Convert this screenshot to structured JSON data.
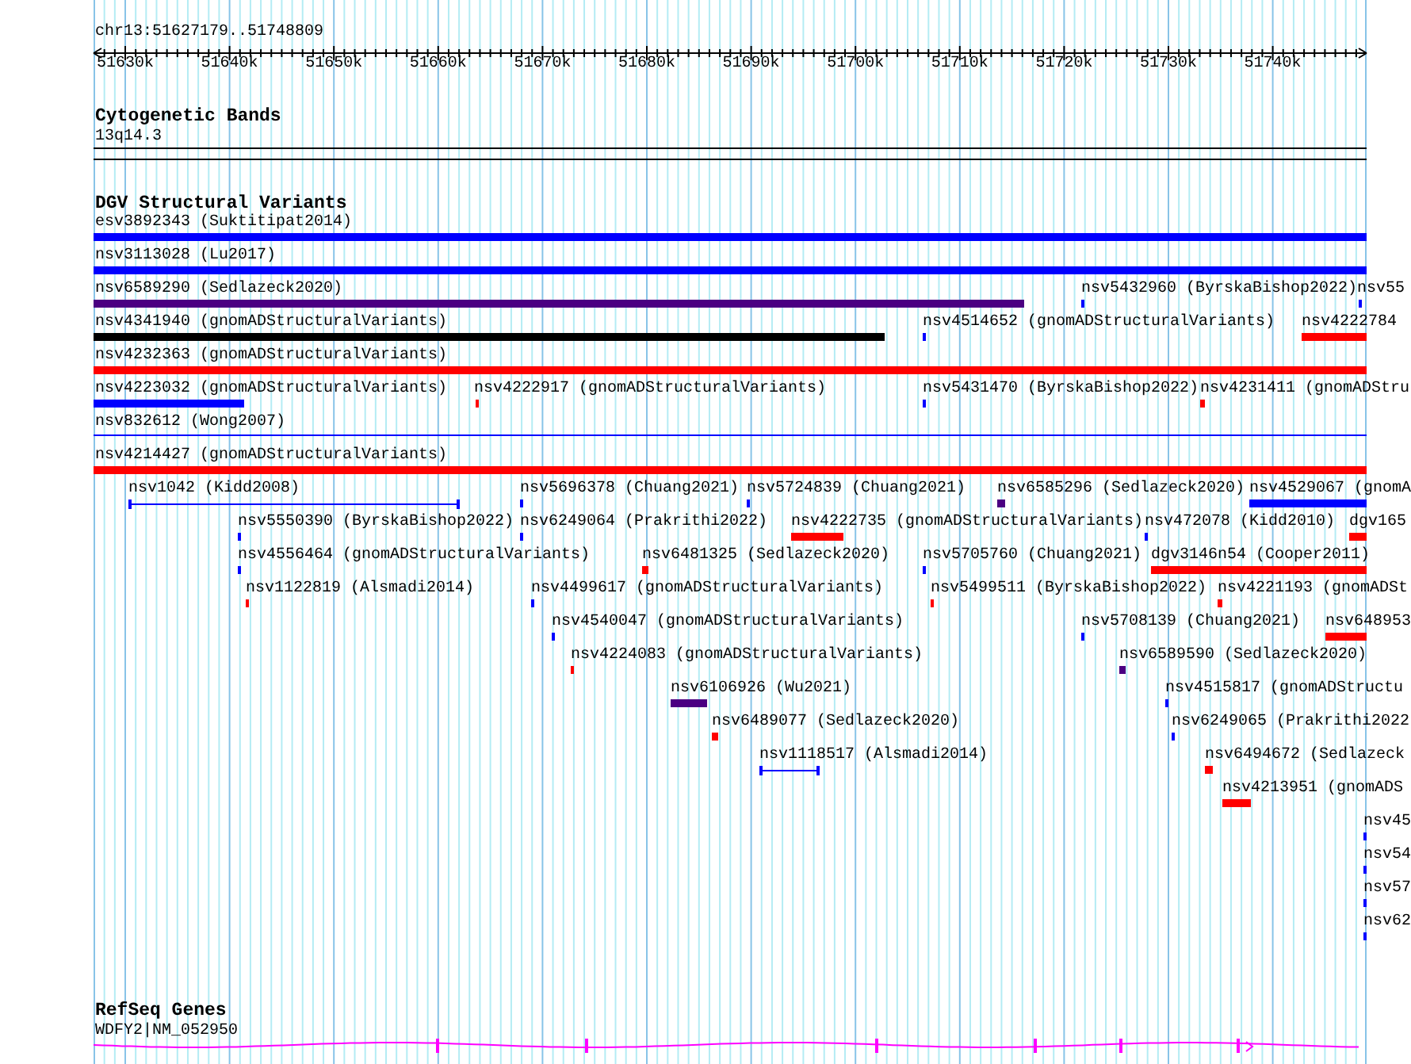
{
  "ruler": {
    "location": "chr13:51627179..51748809",
    "ticks": [
      "51630k",
      "51640k",
      "51650k",
      "51660k",
      "51670k",
      "51680k",
      "51690k",
      "51700k",
      "51710k",
      "51720k",
      "51730k",
      "51740k"
    ]
  },
  "cytoband_track": {
    "title": "Cytogenetic Bands",
    "band": "13q14.3"
  },
  "variant_track": {
    "title": "DGV Structural Variants",
    "features": [
      {
        "label": "esv3892343 (Suktitipat2014)",
        "color": "#0000ff",
        "kind": "bar"
      },
      {
        "label": "nsv3113028 (Lu2017)",
        "color": "#0000ff",
        "kind": "bar"
      },
      {
        "label": "nsv6589290 (Sedlazeck2020)",
        "color": "#4b0082",
        "kind": "bar"
      },
      {
        "label": "nsv5432960 (ByrskaBishop2022)",
        "color": "#0000ff",
        "kind": "bar"
      },
      {
        "label": "nsv55",
        "color": "#0000ff",
        "kind": "bar"
      },
      {
        "label": "nsv4341940 (gnomADStructuralVariants)",
        "color": "#000000",
        "kind": "bar"
      },
      {
        "label": "nsv4514652 (gnomADStructuralVariants)",
        "color": "#0000ff",
        "kind": "bar"
      },
      {
        "label": "nsv4222784",
        "color": "#ff0000",
        "kind": "bar"
      },
      {
        "label": "nsv4232363 (gnomADStructuralVariants)",
        "color": "#ff0000",
        "kind": "bar"
      },
      {
        "label": "nsv4223032 (gnomADStructuralVariants)",
        "color": "#0000ff",
        "kind": "bar"
      },
      {
        "label": "nsv4222917 (gnomADStructuralVariants)",
        "color": "#ff0000",
        "kind": "bar"
      },
      {
        "label": "nsv5431470 (ByrskaBishop2022)",
        "color": "#0000ff",
        "kind": "bar"
      },
      {
        "label": "nsv4231411 (gnomADStru",
        "color": "#ff0000",
        "kind": "bar"
      },
      {
        "label": "nsv832612 (Wong2007)",
        "color": "#0000ff",
        "kind": "line"
      },
      {
        "label": "nsv4214427 (gnomADStructuralVariants)",
        "color": "#ff0000",
        "kind": "bar"
      },
      {
        "label": "nsv1042 (Kidd2008)",
        "color": "#0000ff",
        "kind": "interval"
      },
      {
        "label": "nsv5696378 (Chuang2021)",
        "color": "#0000ff",
        "kind": "bar"
      },
      {
        "label": "nsv5724839 (Chuang2021)",
        "color": "#0000ff",
        "kind": "bar"
      },
      {
        "label": "nsv6585296 (Sedlazeck2020)",
        "color": "#4b0082",
        "kind": "bar"
      },
      {
        "label": "nsv4529067 (gnomA",
        "color": "#0000ff",
        "kind": "bar"
      },
      {
        "label": "nsv5550390 (ByrskaBishop2022)",
        "color": "#0000ff",
        "kind": "bar"
      },
      {
        "label": "nsv6249064 (Prakrithi2022)",
        "color": "#0000ff",
        "kind": "bar"
      },
      {
        "label": "nsv4222735 (gnomADStructuralVariants)",
        "color": "#ff0000",
        "kind": "bar"
      },
      {
        "label": "nsv472078 (Kidd2010)",
        "color": "#0000ff",
        "kind": "bar"
      },
      {
        "label": "dgv165",
        "color": "#ff0000",
        "kind": "bar"
      },
      {
        "label": "nsv4556464 (gnomADStructuralVariants)",
        "color": "#0000ff",
        "kind": "bar"
      },
      {
        "label": "nsv6481325 (Sedlazeck2020)",
        "color": "#ff0000",
        "kind": "bar"
      },
      {
        "label": "nsv5705760 (Chuang2021)",
        "color": "#0000ff",
        "kind": "bar"
      },
      {
        "label": "dgv3146n54 (Cooper2011)",
        "color": "#ff0000",
        "kind": "bar"
      },
      {
        "label": "nsv1122819 (Alsmadi2014)",
        "color": "#ff0000",
        "kind": "bar"
      },
      {
        "label": "nsv4499617 (gnomADStructuralVariants)",
        "color": "#0000ff",
        "kind": "bar"
      },
      {
        "label": "nsv5499511 (ByrskaBishop2022)",
        "color": "#ff0000",
        "kind": "bar"
      },
      {
        "label": "nsv4221193 (gnomADSt",
        "color": "#ff0000",
        "kind": "bar"
      },
      {
        "label": "nsv4540047 (gnomADStructuralVariants)",
        "color": "#0000ff",
        "kind": "bar"
      },
      {
        "label": "nsv5708139 (Chuang2021)",
        "color": "#0000ff",
        "kind": "bar"
      },
      {
        "label": "nsv648953",
        "color": "#ff0000",
        "kind": "bar"
      },
      {
        "label": "nsv4224083 (gnomADStructuralVariants)",
        "color": "#ff0000",
        "kind": "bar"
      },
      {
        "label": "nsv6589590 (Sedlazeck2020)",
        "color": "#4b0082",
        "kind": "bar"
      },
      {
        "label": "nsv6106926 (Wu2021)",
        "color": "#4b0082",
        "kind": "bar"
      },
      {
        "label": "nsv4515817 (gnomADStructu",
        "color": "#0000ff",
        "kind": "bar"
      },
      {
        "label": "nsv6489077 (Sedlazeck2020)",
        "color": "#ff0000",
        "kind": "bar"
      },
      {
        "label": "nsv6249065 (Prakrithi2022",
        "color": "#0000ff",
        "kind": "bar"
      },
      {
        "label": "nsv1118517 (Alsmadi2014)",
        "color": "#0000ff",
        "kind": "interval"
      },
      {
        "label": "nsv6494672 (Sedlazeck",
        "color": "#ff0000",
        "kind": "bar"
      },
      {
        "label": "nsv4213951 (gnomADS",
        "color": "#ff0000",
        "kind": "bar"
      },
      {
        "label": "nsv45",
        "color": "#0000ff",
        "kind": "bar"
      },
      {
        "label": "nsv54",
        "color": "#0000ff",
        "kind": "bar"
      },
      {
        "label": "nsv57",
        "color": "#0000ff",
        "kind": "bar"
      },
      {
        "label": "nsv62",
        "color": "#0000ff",
        "kind": "bar"
      }
    ]
  },
  "gene_track": {
    "title": "RefSeq Genes",
    "gene": "WDFY2|NM_052950"
  }
}
